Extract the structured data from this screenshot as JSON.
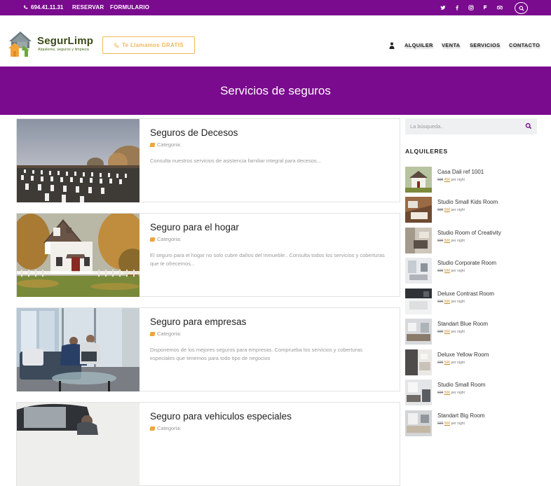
{
  "topbar": {
    "phone": "694.41.11.31",
    "links": [
      "RESERVAR",
      "FORMULARIO"
    ],
    "social_icons": [
      "twitter-icon",
      "facebook-icon",
      "instagram-icon",
      "foursquare-icon",
      "tripadvisor-icon"
    ],
    "colors": {
      "background": "#7a0a8e",
      "text": "#ffffff"
    }
  },
  "header": {
    "brand": "SegurLimp",
    "tagline": "Alquileres, seguros y limpieza",
    "call_button": "Te Llamamos GRATIS",
    "nav": [
      "ALQUILER",
      "VENTA",
      "SERVICIOS",
      "CONTACTO"
    ],
    "colors": {
      "brand": "#3a4a18",
      "cta": "#f0b85c"
    }
  },
  "hero": {
    "title": "Servicios de seguros",
    "color": "#7a0a8e"
  },
  "cards": [
    {
      "title": "Seguros de Decesos",
      "category": "Categoria:",
      "description": "Consulta nuestros servicios de asistencia familiar integral para decesos...",
      "image": "cemetery"
    },
    {
      "title": "Seguro para el hogar",
      "category": "Categoria:",
      "description": "El seguro para el hogar no solo cubre daños del inmueble.. Consulta todos los servicios y coberturas que te ofrecemos...",
      "image": "house"
    },
    {
      "title": "Seguro para empresas",
      "category": "Categoria:",
      "description": "Disponemos de los mejores seguros para empresas. Comprueba los servicios y coberturas especiales que tenemos para todo tipo de negocios",
      "image": "office"
    },
    {
      "title": "Seguro para vehiculos especiales",
      "category": "Categoria:",
      "description": "",
      "image": "vehicle"
    }
  ],
  "sidebar": {
    "search_placeholder": "La búsqueda..",
    "heading": "ALQUILERES",
    "rooms": [
      {
        "name": "Casa Dali ref 1001",
        "old_price": "60€",
        "new_price": "45€",
        "unit": "per night"
      },
      {
        "name": "Studio Small Kids Room",
        "old_price": "60€",
        "new_price": "50€",
        "unit": "per night"
      },
      {
        "name": "Studio Room of Creativity",
        "old_price": "60€",
        "new_price": "50€",
        "unit": "per night"
      },
      {
        "name": "Studio Corporate Room",
        "old_price": "60€",
        "new_price": "50€",
        "unit": "per night"
      },
      {
        "name": "Deluxe Contrast Room",
        "old_price": "60€",
        "new_price": "50€",
        "unit": "per night"
      },
      {
        "name": "Standart Blue Room",
        "old_price": "60€",
        "new_price": "50€",
        "unit": "per night"
      },
      {
        "name": "Deluxe Yellow Room",
        "old_price": "60€",
        "new_price": "50€",
        "unit": "per night"
      },
      {
        "name": "Studio Small Room",
        "old_price": "60€",
        "new_price": "50€",
        "unit": "per night"
      },
      {
        "name": "Standart Big Room",
        "old_price": "60€",
        "new_price": "50€",
        "unit": "per night"
      }
    ]
  }
}
